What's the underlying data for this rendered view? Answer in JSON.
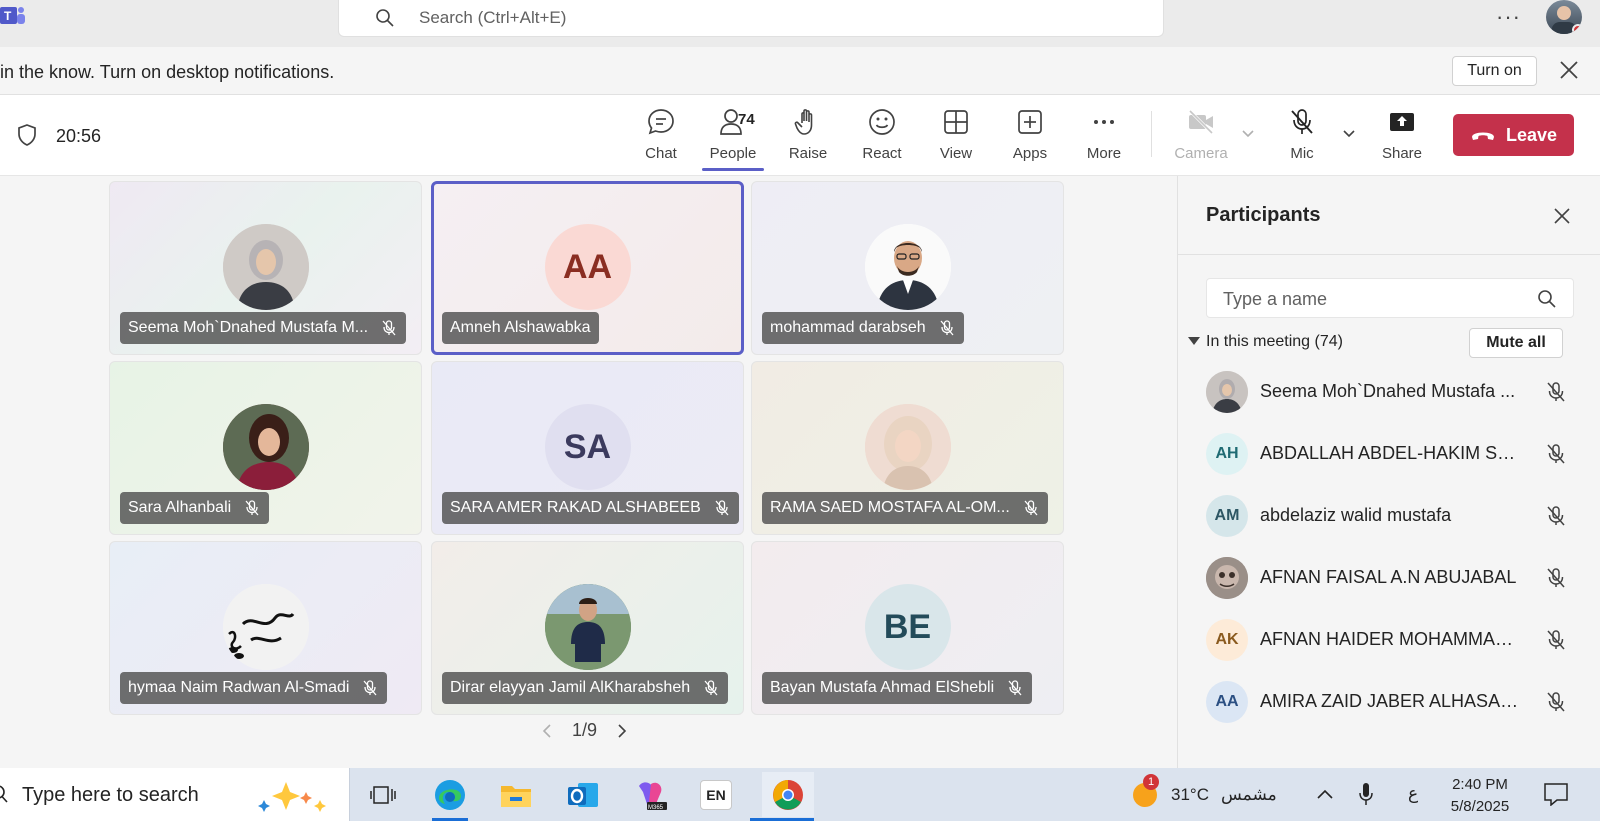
{
  "titlebar": {
    "search_placeholder": "Search (Ctrl+Alt+E)",
    "more_label": "···"
  },
  "notification": {
    "message": "in the know. Turn on desktop notifications.",
    "turn_on_label": "Turn on"
  },
  "toolbar": {
    "timer": "20:56",
    "buttons": {
      "chat": "Chat",
      "people": "People",
      "people_count": "74",
      "raise": "Raise",
      "react": "React",
      "view": "View",
      "apps": "Apps",
      "more": "More",
      "camera": "Camera",
      "mic": "Mic",
      "share": "Share"
    },
    "leave_label": "Leave",
    "colors": {
      "accent": "#5b5fc7",
      "leave": "#c4314b"
    }
  },
  "stage": {
    "tiles": [
      {
        "name": "Seema Moh`Dnahed Mustafa M...",
        "initials": "",
        "muted": true
      },
      {
        "name": "Amneh Alshawabka",
        "initials": "AA",
        "muted": false,
        "active": true
      },
      {
        "name": "mohammad darabseh",
        "initials": "",
        "muted": true
      },
      {
        "name": "Sara Alhanbali",
        "initials": "",
        "muted": true
      },
      {
        "name": "SARA AMER RAKAD ALSHABEEB",
        "initials": "SA",
        "muted": true
      },
      {
        "name": "RAMA SAED MOSTAFA AL-OM...",
        "initials": "",
        "muted": true
      },
      {
        "name": "hymaa Naim Radwan Al-Smadi",
        "initials": "",
        "muted": true
      },
      {
        "name": "Dirar elayyan Jamil AlKharabsheh",
        "initials": "",
        "muted": true
      },
      {
        "name": "Bayan Mustafa Ahmad ElShebli",
        "initials": "BE",
        "muted": true
      }
    ],
    "pager": "1/9"
  },
  "participants": {
    "title": "Participants",
    "search_placeholder": "Type a name",
    "section_label": "In this meeting (74)",
    "mute_all_label": "Mute all",
    "items": [
      {
        "name": "Seema Moh`Dnahed Mustafa ...",
        "initials": ""
      },
      {
        "name": "ABDALLAH ABDEL-HAKIM SAL...",
        "initials": "AH"
      },
      {
        "name": "abdelaziz walid mustafa",
        "initials": "AM"
      },
      {
        "name": "AFNAN FAISAL A.N ABUJABAL",
        "initials": ""
      },
      {
        "name": "AFNAN HAIDER MOHAMMAD...",
        "initials": "AK"
      },
      {
        "name": "AMIRA ZAID JABER ALHASABE...",
        "initials": "AA"
      }
    ]
  },
  "taskbar": {
    "search_placeholder": "Type here to search",
    "lang_label": "EN",
    "weather_badge": "1",
    "temperature": "31°C",
    "weather_text": "مشمس",
    "ime_label": "ع",
    "time": "2:40 PM",
    "date": "5/8/2025"
  }
}
